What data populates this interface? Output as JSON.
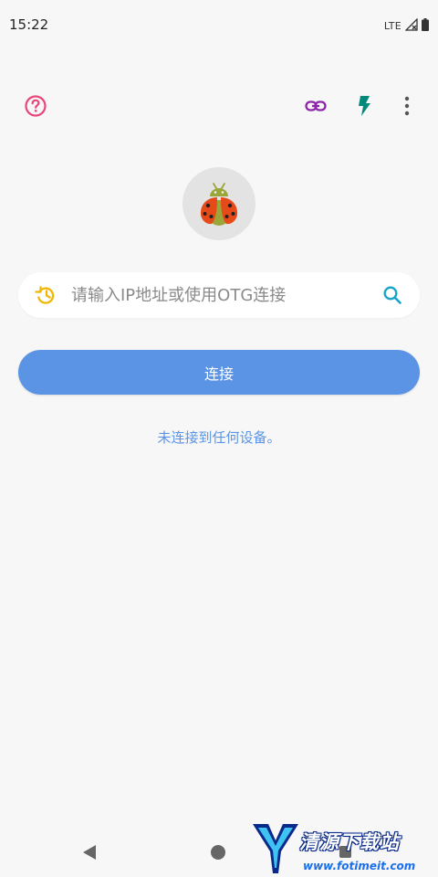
{
  "status_bar": {
    "time": "15:22",
    "network": "LTE"
  },
  "toolbar": {
    "help_icon": "help-circle-icon",
    "link_icon": "link-icon",
    "flash_icon": "flash-icon",
    "more_icon": "more-vert-icon"
  },
  "logo": {
    "icon": "ladybug-android-icon"
  },
  "search": {
    "placeholder": "请输入IP地址或使用OTG连接",
    "value": "",
    "history_icon": "history-icon",
    "search_icon": "search-icon"
  },
  "connect_button": {
    "label": "连接"
  },
  "status_message": "未连接到任何设备。",
  "watermark": {
    "text": "清源下载站",
    "url": "www.fotimeit.com"
  },
  "colors": {
    "background": "#f7f7f7",
    "accent_blue": "#5b94e5",
    "help_pink": "#e8467a",
    "link_purple": "#8e24aa",
    "flash_teal": "#00897b",
    "history_yellow": "#f2b705",
    "search_cyan": "#18a5c9"
  }
}
